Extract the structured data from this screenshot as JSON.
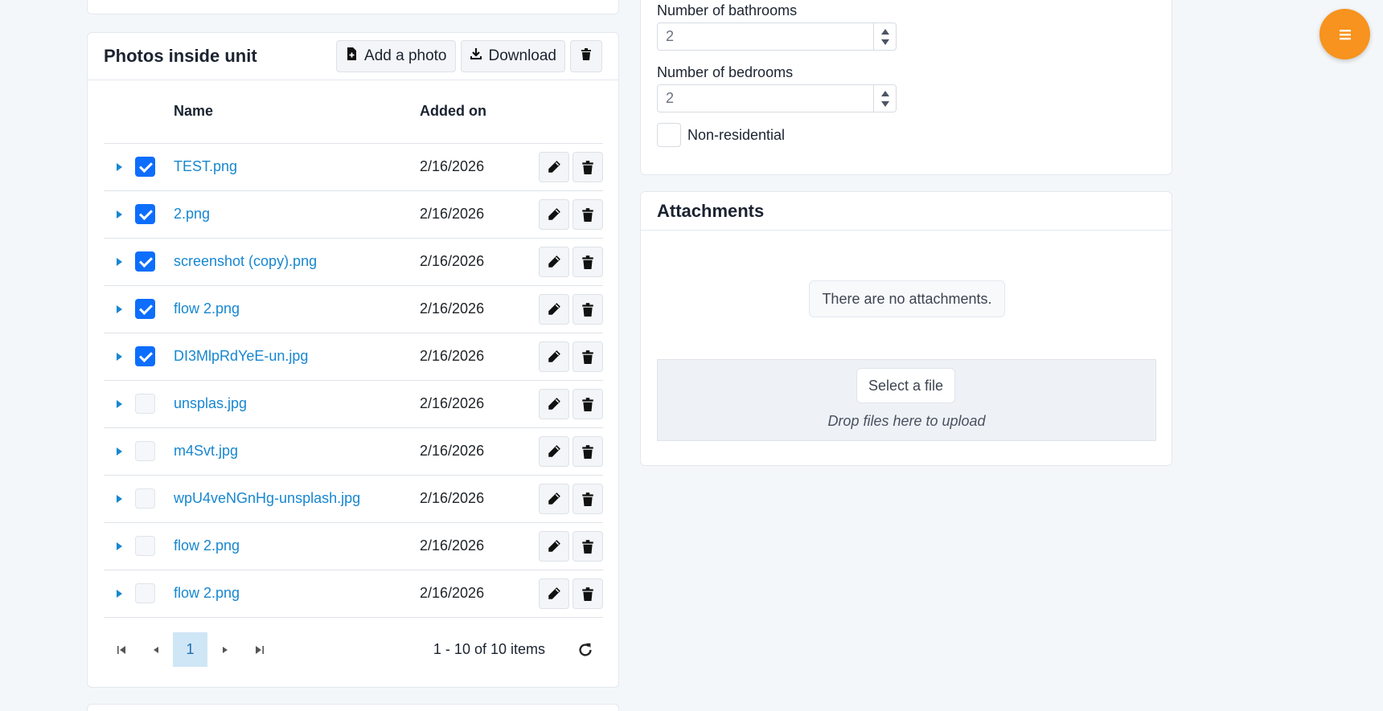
{
  "photos": {
    "title": "Photos inside unit",
    "add_label": "Add a photo",
    "download_label": "Download",
    "columns": {
      "name": "Name",
      "added_on": "Added on"
    },
    "rows": [
      {
        "name": "TEST.png",
        "date": "2/16/2026",
        "checked": true
      },
      {
        "name": "2.png",
        "date": "2/16/2026",
        "checked": true
      },
      {
        "name": "screenshot (copy).png",
        "date": "2/16/2026",
        "checked": true
      },
      {
        "name": "flow 2.png",
        "date": "2/16/2026",
        "checked": true
      },
      {
        "name": "DI3MlpRdYeE-un.jpg",
        "date": "2/16/2026",
        "checked": true
      },
      {
        "name": "unsplas.jpg",
        "date": "2/16/2026",
        "checked": false
      },
      {
        "name": "m4Svt.jpg",
        "date": "2/16/2026",
        "checked": false
      },
      {
        "name": "wpU4veNGnHg-unsplash.jpg",
        "date": "2/16/2026",
        "checked": false
      },
      {
        "name": "flow 2.png",
        "date": "2/16/2026",
        "checked": false
      },
      {
        "name": "flow 2.png",
        "date": "2/16/2026",
        "checked": false
      }
    ],
    "pager": {
      "current_page": "1",
      "info": "1 - 10 of 10 items"
    }
  },
  "details": {
    "bathrooms_label": "Number of bathrooms",
    "bathrooms_value": "2",
    "bedrooms_label": "Number of bedrooms",
    "bedrooms_value": "2",
    "nonresidential_label": "Non-residential"
  },
  "attachments": {
    "title": "Attachments",
    "empty_message": "There are no attachments.",
    "select_file_label": "Select a file",
    "drop_hint": "Drop files here to upload"
  },
  "colors": {
    "accent": "#1787d0",
    "checkbox": "#0d6efd",
    "fab": "#f7931e",
    "background": "#f4f7fa"
  },
  "icons": {
    "add": "file-plus-icon",
    "download": "download-icon",
    "delete": "trash-icon",
    "edit": "pencil-icon",
    "expand": "caret-right-icon",
    "refresh": "refresh-icon",
    "menu": "hamburger-icon"
  }
}
